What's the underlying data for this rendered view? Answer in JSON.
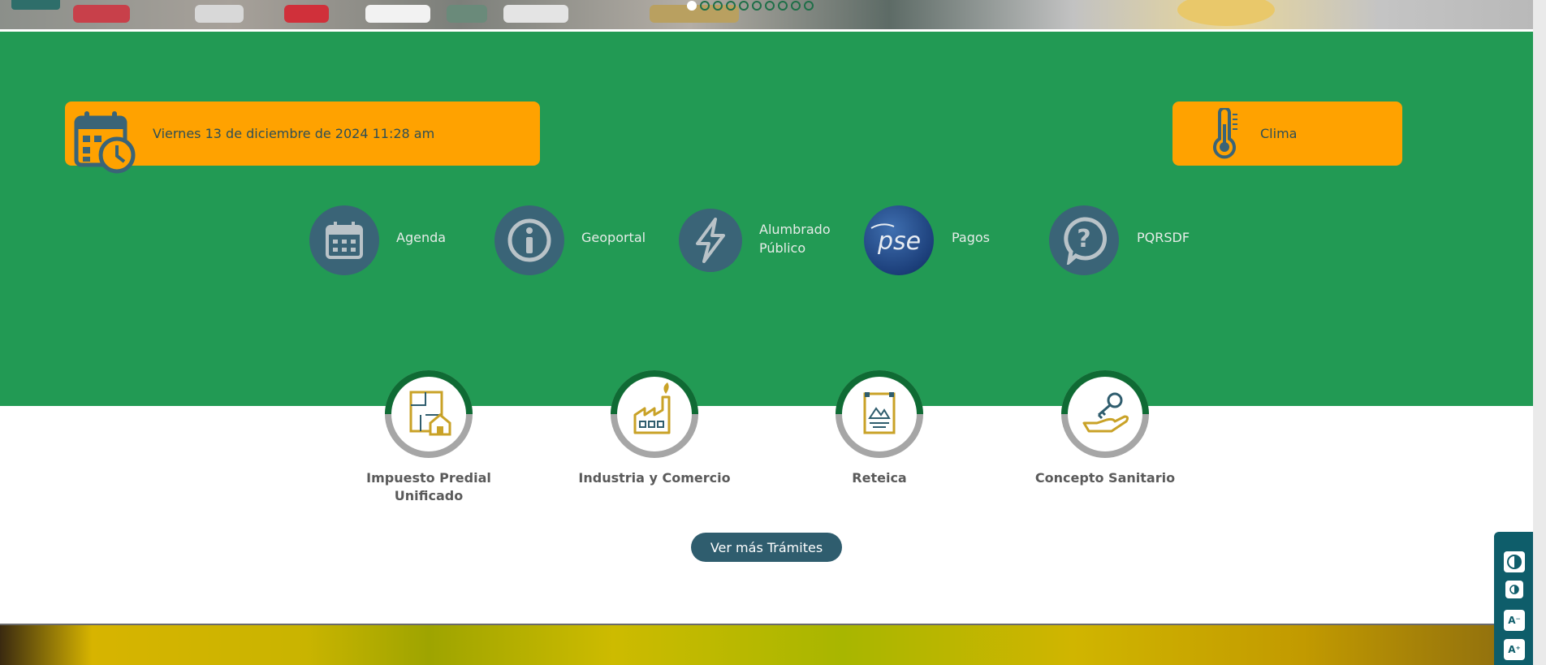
{
  "slider": {
    "dot_count": 10,
    "active_index": 0
  },
  "date_card": {
    "text": "Viernes 13 de diciembre de 2024 11:28 am",
    "icon": "calendar-clock-icon"
  },
  "clima_card": {
    "label": "Clima",
    "icon": "thermometer-icon"
  },
  "quick_links": [
    {
      "label": "Agenda",
      "icon": "calendar-icon"
    },
    {
      "label": "Geoportal",
      "icon": "info-icon"
    },
    {
      "label_line1": "Alumbrado",
      "label_line2": "Público",
      "icon": "lightning-icon"
    },
    {
      "label": "Pagos",
      "icon": "pse-logo"
    },
    {
      "label": "PQRSDF",
      "icon": "question-bubble-icon"
    }
  ],
  "tramites": [
    {
      "label_line1": "Impuesto Predial",
      "label_line2": "Unificado",
      "icon": "house-plan-icon"
    },
    {
      "label": "Industria y Comercio",
      "icon": "factory-icon"
    },
    {
      "label": "Reteica",
      "icon": "poster-icon"
    },
    {
      "label": "Concepto Sanitario",
      "icon": "hand-key-icon"
    }
  ],
  "ver_mas_label": "Ver más Trámites",
  "colors": {
    "green": "#229a54",
    "orange": "#ffa200",
    "dark_teal": "#2f5d6e",
    "gold_icon": "#c9a227"
  }
}
